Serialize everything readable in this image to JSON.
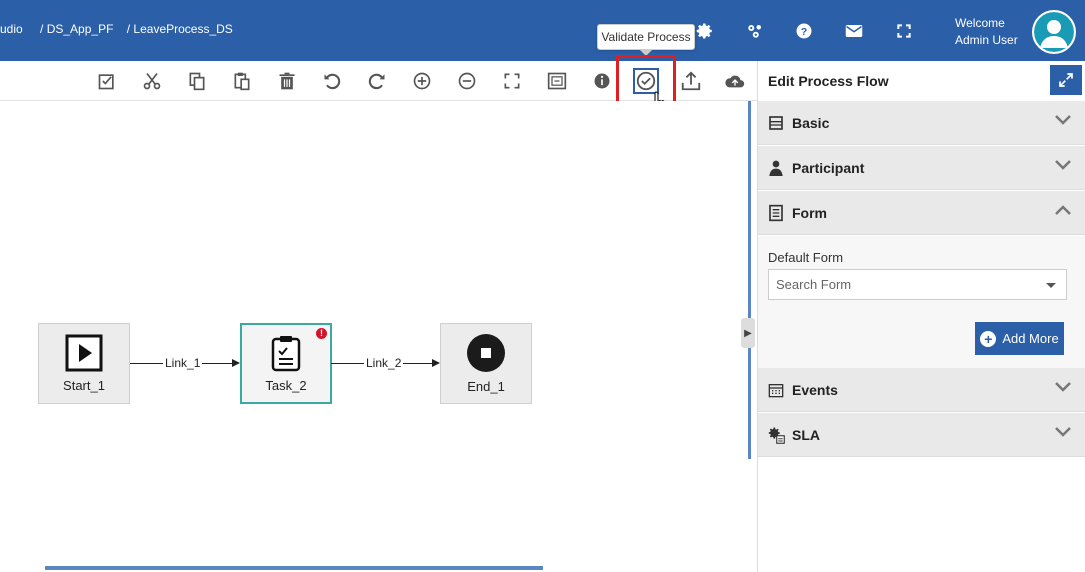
{
  "header": {
    "breadcrumb": [
      "udio",
      "/ DS_App_PF",
      "/ LeaveProcess_DS"
    ],
    "welcome_line1": "Welcome",
    "welcome_line2": "Admin User",
    "icons": [
      "gear-icon",
      "settings-cluster-icon",
      "help-icon",
      "mail-icon",
      "fullscreen-icon"
    ]
  },
  "toolbar": {
    "tooltip": "Validate Process",
    "buttons": [
      "select-all-icon",
      "cut-icon",
      "copy-icon",
      "paste-icon",
      "delete-icon",
      "undo-icon",
      "redo-icon",
      "zoom-in-icon",
      "zoom-out-icon",
      "fit-screen-icon",
      "overview-icon",
      "info-icon",
      "validate-icon",
      "upload-icon",
      "cloud-icon"
    ]
  },
  "diagram": {
    "nodes": [
      {
        "label": "Start_1",
        "type": "start"
      },
      {
        "label": "Task_2",
        "type": "task",
        "warning": "!"
      },
      {
        "label": "End_1",
        "type": "end"
      }
    ],
    "links": [
      {
        "label": "Link_1"
      },
      {
        "label": "Link_2"
      }
    ]
  },
  "panel": {
    "title": "Edit Process Flow",
    "sections": [
      {
        "title": "Basic",
        "expanded": false
      },
      {
        "title": "Participant",
        "expanded": false
      },
      {
        "title": "Form",
        "expanded": true
      },
      {
        "title": "Events",
        "expanded": false
      },
      {
        "title": "SLA",
        "expanded": false
      }
    ],
    "form": {
      "label": "Default Form",
      "placeholder": "Search Form",
      "add_more": "Add More"
    }
  },
  "colors": {
    "header": "#2b5fa8",
    "highlight": "#e02020",
    "task_border": "#3aa99f"
  }
}
